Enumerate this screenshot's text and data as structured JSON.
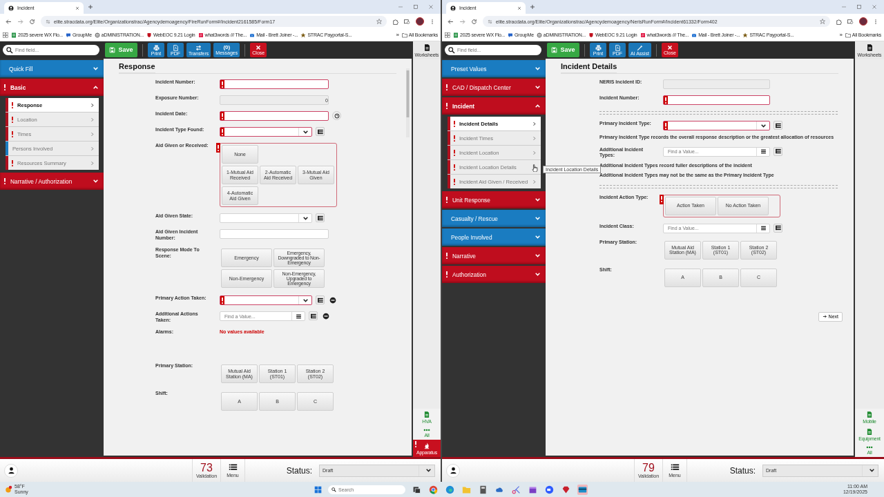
{
  "windows": [
    {
      "tab": "Incident",
      "url": "elite.stracdata.org/Elite/Organizationstrac/Agencydemoagency/FireRunForm#/Incident2161585/Form17",
      "bookmarks": [
        {
          "kind": "sheet",
          "label": "2025 severe WX Flo..."
        },
        {
          "kind": "chat",
          "label": "GroupMe"
        },
        {
          "kind": "globe",
          "label": "aDMINISTRATION..."
        },
        {
          "kind": "shield",
          "label": "WebEOC 9.21  Login"
        },
        {
          "kind": "grid",
          "label": "what3words /// The..."
        },
        {
          "kind": "mail",
          "label": "Mail - Brett Joiner -..."
        },
        {
          "kind": "star",
          "label": "STRAC Payportal-S..."
        }
      ],
      "bookmarks_more": "»",
      "all_bookmarks": "All Bookmarks",
      "search_placeholder": "Find field...",
      "tools": [
        {
          "kind": "save",
          "label": "Save"
        },
        {
          "kind": "print",
          "label": "Print"
        },
        {
          "kind": "pdf",
          "label": "PDF"
        },
        {
          "kind": "transfers",
          "label": "Transfers"
        },
        {
          "kind": "messages",
          "count": "(0)",
          "label": "Messages"
        },
        {
          "kind": "close",
          "label": "Close"
        }
      ],
      "sections": [
        {
          "label": "Quick Fill",
          "color": "#1a7cc1",
          "alert": false,
          "expanded": false
        },
        {
          "label": "Basic",
          "color": "#bf0d1e",
          "alert": true,
          "expanded": true,
          "items": [
            {
              "label": "Response",
              "alert": true,
              "selected": true
            },
            {
              "label": "Location",
              "alert": true,
              "selected": false
            },
            {
              "label": "Times",
              "alert": true,
              "selected": false
            },
            {
              "label": "Persons Involved",
              "alert": false,
              "selected": false
            },
            {
              "label": "Resources Summary",
              "alert": true,
              "selected": false
            }
          ]
        },
        {
          "label": "Narrative / Authorization",
          "color": "#bf0d1e",
          "alert": true,
          "expanded": false
        }
      ],
      "form": {
        "title": "Response",
        "scrollbar": true,
        "fields": [
          {
            "kind": "text",
            "label": "Incident Number:",
            "required": true
          },
          {
            "kind": "text",
            "label": "Exposure Number:",
            "value": "0",
            "readonly": true
          },
          {
            "kind": "text",
            "label": "Incident Date:",
            "required": true,
            "tools": [
              {
                "kind": "clock"
              }
            ]
          },
          {
            "kind": "select",
            "label": "Incident Type Found:",
            "required": true,
            "tools": [
              {
                "kind": "list"
              }
            ]
          },
          {
            "kind": "buttons",
            "label": "Aid Given or Received:",
            "required": true,
            "rows": [
              [
                "None"
              ],
              [
                "1-Mutual Aid Received",
                "2-Automatic Aid Received",
                "3-Mutual Aid Given"
              ],
              [
                "4-Automatic Aid Given"
              ]
            ]
          },
          {
            "kind": "select",
            "label": "Aid Given State:",
            "tools": [
              {
                "kind": "list"
              }
            ]
          },
          {
            "kind": "text",
            "label": "Aid Given Incident Number:"
          },
          {
            "kind": "buttons",
            "label": "Response Mode To Scene:",
            "rows": [
              [
                "Emergency",
                "Emergency, Downgraded to Non-Emergency"
              ],
              [
                "Non-Emergency",
                "Non-Emergency, Upgraded to Emergency"
              ]
            ]
          },
          {
            "kind": "select",
            "label": "Primary Action Taken:",
            "required": true,
            "tools": [
              {
                "kind": "list"
              },
              {
                "kind": "minus"
              }
            ]
          },
          {
            "kind": "search",
            "label": "Additional Actions Taken:",
            "placeholder": "Find a Value...",
            "tools": [
              {
                "kind": "list"
              },
              {
                "kind": "minus"
              }
            ]
          },
          {
            "kind": "message",
            "label": "Alarms:",
            "text": "No values available"
          },
          {
            "kind": "buttons",
            "label": "Primary Station:",
            "rows": [
              [
                "Mutual Aid Station (MA)",
                "Station 1 (ST01)",
                "Station 2 (ST02)"
              ]
            ]
          },
          {
            "kind": "buttons",
            "label": "Shift:",
            "rows": [
              [
                "A",
                "B",
                "C"
              ]
            ]
          }
        ]
      },
      "rail_top": {
        "kind": "doc",
        "label": "Worksheets"
      },
      "rail": [
        {
          "kind": "greendoc",
          "label": "HVA",
          "alert": false
        },
        {
          "kind": "dots",
          "label": "All",
          "alert": false
        },
        {
          "kind": "flame",
          "label": "Apparatus",
          "alert": true
        }
      ],
      "validation": {
        "count": "73",
        "label": "Validation"
      },
      "menu": "Menu",
      "status_label": "Status:",
      "status": "Draft"
    },
    {
      "tab": "Incident",
      "url": "elite.stracdata.org/Elite/Organizationstrac/Agencydemoagency/NerisRunForm#/Incident61332/Form402",
      "bookmarks": [
        {
          "kind": "sheet",
          "label": "2025 severe WX Flo..."
        },
        {
          "kind": "chat",
          "label": "GroupMe"
        },
        {
          "kind": "globe",
          "label": "aDMINISTRATION..."
        },
        {
          "kind": "shield",
          "label": "WebEOC 9.21  Login"
        },
        {
          "kind": "grid",
          "label": "what3words /// The..."
        },
        {
          "kind": "mail",
          "label": "Mail - Brett Joiner -..."
        },
        {
          "kind": "star",
          "label": "STRAC Payportal-S..."
        }
      ],
      "bookmarks_more": "»",
      "all_bookmarks": "All Bookmarks",
      "search_placeholder": "Find field...",
      "tools": [
        {
          "kind": "save",
          "label": "Save"
        },
        {
          "kind": "print",
          "label": "Print"
        },
        {
          "kind": "pdf",
          "label": "PDF"
        },
        {
          "kind": "ai",
          "label": "AI Assist"
        },
        {
          "kind": "close",
          "label": "Close"
        }
      ],
      "sections": [
        {
          "label": "Preset Values",
          "color": "#1a7cc1",
          "alert": false,
          "expanded": false
        },
        {
          "label": "CAD / Dispatch Center",
          "color": "#bf0d1e",
          "alert": true,
          "expanded": false
        },
        {
          "label": "Incident",
          "color": "#bf0d1e",
          "alert": true,
          "expanded": true,
          "items": [
            {
              "label": "Incident Details",
              "alert": true,
              "selected": true
            },
            {
              "label": "Incident Times",
              "alert": true,
              "selected": false
            },
            {
              "label": "Incident Location",
              "alert": true,
              "selected": false
            },
            {
              "label": "Incident Location Details",
              "alert": true,
              "selected": false,
              "tooltip": "Incident Location Details"
            },
            {
              "label": "Incident Aid Given / Received",
              "alert": true,
              "selected": false
            }
          ]
        },
        {
          "label": "Unit Response",
          "color": "#bf0d1e",
          "alert": true,
          "expanded": false
        },
        {
          "label": "Casualty / Rescue",
          "color": "#1a7cc1",
          "alert": false,
          "expanded": false
        },
        {
          "label": "People Involved",
          "color": "#1a7cc1",
          "alert": false,
          "expanded": false
        },
        {
          "label": "Narrative",
          "color": "#bf0d1e",
          "alert": true,
          "expanded": false
        },
        {
          "label": "Authorization",
          "color": "#bf0d1e",
          "alert": true,
          "expanded": false
        }
      ],
      "form": {
        "title": "Incident Details",
        "next": "Next",
        "fields": [
          {
            "kind": "text",
            "label": "NERIS Incident ID:",
            "readonly": true
          },
          {
            "kind": "text",
            "label": "Incident Number:",
            "required": true
          },
          {
            "kind": "divider"
          },
          {
            "kind": "select",
            "label": "Primary Incident Type:",
            "required": true,
            "tools": [
              {
                "kind": "list"
              }
            ]
          },
          {
            "kind": "note",
            "text": "Primary Incident Type records the overall response description or the greatest allocation of resources"
          },
          {
            "kind": "search",
            "label": "Additional Incident Types:",
            "placeholder": "Find a Value...",
            "tools": [
              {
                "kind": "list"
              }
            ]
          },
          {
            "kind": "note",
            "text": "Additional Incident Types record fuller descriptions of the incident"
          },
          {
            "kind": "note",
            "text": "Additional Incident Types may not be the same as the Primary Incident Type"
          },
          {
            "kind": "divider"
          },
          {
            "kind": "buttons",
            "label": "Incident Action Type:",
            "required": true,
            "rows": [
              [
                "Action Taken",
                "No Action Taken"
              ]
            ]
          },
          {
            "kind": "search",
            "label": "Incident Class:",
            "placeholder": "Find a Value...",
            "tools": [
              {
                "kind": "list"
              }
            ]
          },
          {
            "kind": "buttons",
            "label": "Primary Station:",
            "rows": [
              [
                "Mutual Aid Station (MA)",
                "Station 1 (ST01)",
                "Station 2 (ST02)"
              ]
            ]
          },
          {
            "kind": "buttons",
            "label": "Shift:",
            "rows": [
              [
                "A",
                "B",
                "C"
              ]
            ]
          }
        ]
      },
      "rail_top": {
        "kind": "doc",
        "label": "Worksheets"
      },
      "rail": [
        {
          "kind": "greendoc",
          "label": "Mobile",
          "alert": false
        },
        {
          "kind": "greendoc",
          "label": "Equipment",
          "alert": false
        },
        {
          "kind": "dots",
          "label": "All",
          "alert": false
        }
      ],
      "validation": {
        "count": "79",
        "label": "Validation"
      },
      "menu": "Menu",
      "status_label": "Status:",
      "status": "Draft"
    }
  ],
  "taskbar": {
    "temp": "58°F",
    "condition": "Sunny",
    "search_placeholder": "Search",
    "time": "11:00 AM",
    "date": "12/19/2025",
    "apps": [
      {
        "kind": "tasks",
        "active": false
      },
      {
        "kind": "chrome",
        "active": false
      },
      {
        "kind": "edge",
        "active": false
      },
      {
        "kind": "folder",
        "active": false
      },
      {
        "kind": "calc",
        "active": false
      },
      {
        "kind": "cloud",
        "active": false
      },
      {
        "kind": "snip",
        "active": false
      },
      {
        "kind": "clap",
        "active": false
      },
      {
        "kind": "zoom",
        "active": false
      },
      {
        "kind": "gem",
        "active": false
      },
      {
        "kind": "card",
        "active": true
      }
    ]
  }
}
